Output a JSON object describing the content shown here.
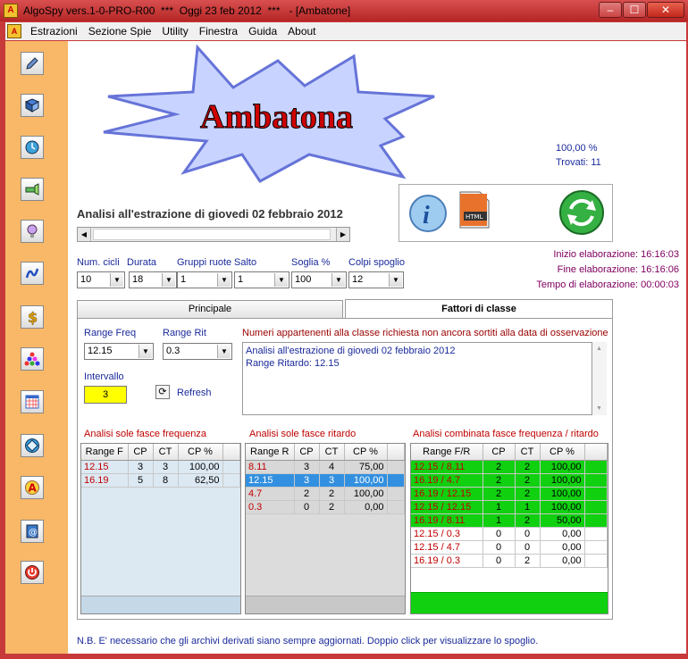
{
  "window": {
    "title": "AlgoSpy vers.1-0-PRO-R00  ***  Oggi 23 feb 2012  ***   - [Ambatone]",
    "btn_min": "–",
    "btn_max": "☐",
    "btn_close": "✕"
  },
  "menu": [
    "Estrazioni",
    "Sezione Spie",
    "Utility",
    "Finestra",
    "Guida",
    "About"
  ],
  "logo": {
    "text": "Ambatona"
  },
  "stats": {
    "percent": "100,00 %",
    "found": "Trovati: 11"
  },
  "analysis_title": "Analisi all'estrazione di giovedi 02 febbraio 2012",
  "timing": {
    "start": "Inizio elaborazione: 16:16:03",
    "end": "Fine elaborazione: 16:16:06",
    "elapsed": "Tempo di elaborazione: 00:00:03"
  },
  "params": {
    "labels": [
      "Num. cicli",
      "Durata",
      "Gruppi ruote",
      "Salto",
      "Soglia %",
      "Colpi spoglio"
    ],
    "values": [
      "10",
      "18",
      "1",
      "1",
      "100",
      "12"
    ]
  },
  "tabs": {
    "principale": "Principale",
    "fattori": "Fattori di classe"
  },
  "fattori": {
    "range_freq_label": "Range Freq",
    "range_freq_value": "12.15",
    "range_rit_label": "Range Rit",
    "range_rit_value": "0.3",
    "intervallo_label": "Intervallo",
    "intervallo_value": "3",
    "refresh": "Refresh",
    "memo_label": "Numeri appartenenti alla classe richiesta non ancora sortiti alla data di osservazione",
    "memo_line1": "Analisi all'estrazione di giovedi 02 febbraio 2012",
    "memo_line2": "Range Ritardo: 12.15"
  },
  "grid_freq": {
    "title": "Analisi sole fasce frequenza",
    "headers": [
      "Range F",
      "CP",
      "CT",
      "CP %"
    ],
    "rows": [
      [
        "12.15",
        "3",
        "3",
        "100,00"
      ],
      [
        "16.19",
        "5",
        "8",
        "62,50"
      ]
    ]
  },
  "grid_rit": {
    "title": "Analisi sole fasce ritardo",
    "headers": [
      "Range R",
      "CP",
      "CT",
      "CP %"
    ],
    "rows": [
      [
        "8.11",
        "3",
        "4",
        "75,00"
      ],
      [
        "12.15",
        "3",
        "3",
        "100,00"
      ],
      [
        "4.7",
        "2",
        "2",
        "100,00"
      ],
      [
        "0.3",
        "0",
        "2",
        "0,00"
      ]
    ]
  },
  "grid_comb": {
    "title": "Analisi combinata fasce frequenza / ritardo",
    "headers": [
      "Range F/R",
      "CP",
      "CT",
      "CP %"
    ],
    "rows": [
      [
        "12.15 / 8.11",
        "2",
        "2",
        "100,00"
      ],
      [
        "16.19 / 4.7",
        "2",
        "2",
        "100,00"
      ],
      [
        "16.19 / 12.15",
        "2",
        "2",
        "100,00"
      ],
      [
        "12.15 / 12.15",
        "1",
        "1",
        "100,00"
      ],
      [
        "16.19 / 8.11",
        "1",
        "2",
        "50,00"
      ],
      [
        "12.15 / 0.3",
        "0",
        "0",
        "0,00"
      ],
      [
        "12.15 / 4.7",
        "0",
        "0",
        "0,00"
      ],
      [
        "16.19 / 0.3",
        "0",
        "2",
        "0,00"
      ]
    ]
  },
  "footer_note": "N.B. E' necessario che gli archivi derivati siano sempre aggiornati. Doppio click per visualizzare lo spoglio.",
  "colors": {
    "accent_red": "#c00000",
    "sidebar": "#f8b868",
    "green_grid": "#10d010"
  }
}
